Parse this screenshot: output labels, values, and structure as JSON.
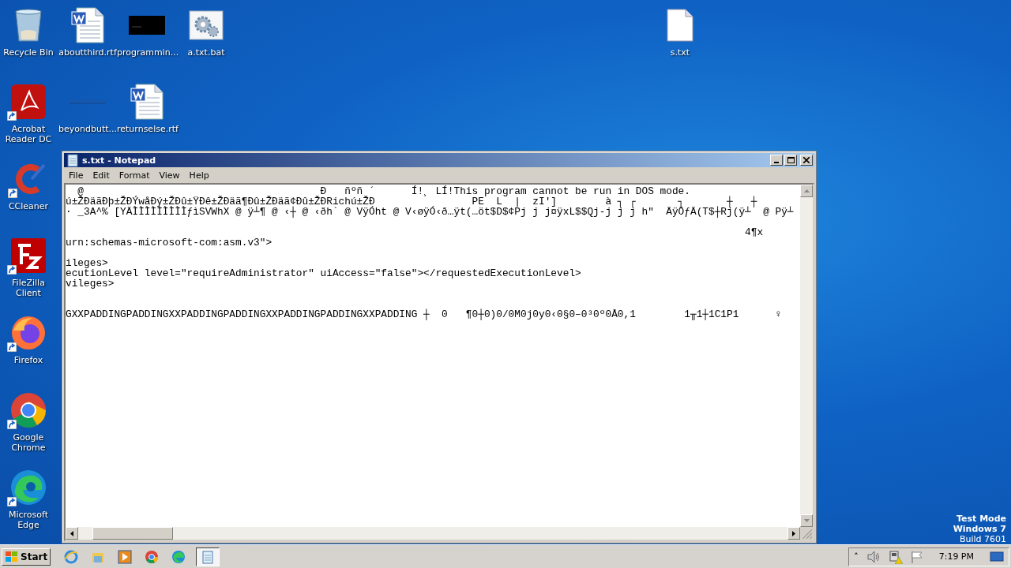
{
  "desktop": {
    "icons": [
      {
        "label": "Recycle Bin",
        "kind": "recycle",
        "shortcut": false
      },
      {
        "label": "aboutthird.rtf",
        "kind": "word",
        "shortcut": false
      },
      {
        "label": "programmin...",
        "kind": "console",
        "shortcut": false
      },
      {
        "label": "a.txt.bat",
        "kind": "batch",
        "shortcut": false
      },
      {
        "label": "s.txt",
        "kind": "text",
        "shortcut": false
      },
      {
        "label": "Acrobat Reader DC",
        "kind": "acrobat",
        "shortcut": true
      },
      {
        "label": "beyondbutt...",
        "kind": "blank",
        "shortcut": false
      },
      {
        "label": "returnselse.rtf",
        "kind": "word",
        "shortcut": false
      },
      {
        "label": "CCleaner",
        "kind": "ccleaner",
        "shortcut": true
      },
      {
        "label": "FileZilla Client",
        "kind": "filezilla",
        "shortcut": true
      },
      {
        "label": "Firefox",
        "kind": "firefox",
        "shortcut": true
      },
      {
        "label": "Google Chrome",
        "kind": "chrome",
        "shortcut": true
      },
      {
        "label": "Microsoft Edge",
        "kind": "edge",
        "shortcut": true
      }
    ],
    "watermark_lines": [
      "Test Mode",
      "Windows 7",
      "Build 7601"
    ]
  },
  "notepad": {
    "title": "s.txt - Notepad",
    "menu": [
      "File",
      "Edit",
      "Format",
      "View",
      "Help"
    ],
    "lines": [
      {
        "kind": "text",
        "text": "  @                                       Ð   ñºñ ´      Í!¸ LÍ!This program cannot be run in DOS mode."
      },
      {
        "kind": "text",
        "text": "ú±ŽÐäãÐþ±ŽÐÝwåÐý±ŽÐû±ŸÐê±ŽÐäã¶Ðû±ŽÐäã¢Ðû±ŽÐRichú±ŽÐ                PE  L  |  zI']        à ┐ ┌       ┐       ┼   ┼"
      },
      {
        "kind": "text",
        "text": "· _3A^% [YÄÌÌÌÌÌÌÌÌÌƒìSVWhX @ ÿ┴¶ @ ‹┼ @ ‹ðh` @ VÿÓht @ V‹øÿÓ‹ð…ÿt(…öt$D$¢Pj j j¤ÿxL$$Qj-j j j h\"  ÄÿÖƒÄ(T$┼Rj(ÿ┴  @ Pÿ┴"
      },
      {
        "kind": "blank"
      },
      {
        "kind": "text",
        "text": "                                                                                                                4¶x"
      },
      {
        "kind": "text",
        "text": "urn:schemas-microsoft-com:asm.v3\">"
      },
      {
        "kind": "blank"
      },
      {
        "kind": "text",
        "text": "ileges>"
      },
      {
        "kind": "text",
        "text": "ecutionLevel level=\"requireAdministrator\" uiAccess=\"false\"></requestedExecutionLevel>"
      },
      {
        "kind": "text",
        "text": "vileges>"
      },
      {
        "kind": "blank"
      },
      {
        "kind": "blank"
      },
      {
        "kind": "text",
        "text": "GXXPADDINGPADDINGXXPADDINGPADDINGXXPADDINGPADDINGXXPADDING ┼  0   ¶0┼0)0/0M0j0y0‹0§0–0³0º0Å0,1        1╥1┼1C1P1      ♀"
      }
    ]
  },
  "taskbar": {
    "start": "Start",
    "apps": [
      {
        "kind": "ie",
        "selected": false
      },
      {
        "kind": "folder",
        "selected": false
      },
      {
        "kind": "media",
        "selected": false
      },
      {
        "kind": "chrome",
        "selected": false
      },
      {
        "kind": "edge",
        "selected": false
      },
      {
        "kind": "notepad",
        "selected": true
      }
    ],
    "tray": {
      "chevron": "˄",
      "clock": "7:19 PM"
    }
  }
}
